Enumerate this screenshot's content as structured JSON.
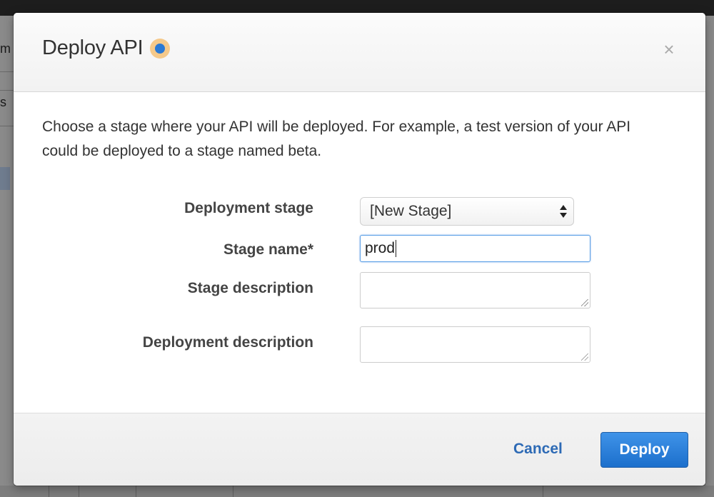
{
  "background": {
    "fragments": [
      "m",
      "s"
    ]
  },
  "modal": {
    "title": "Deploy API",
    "close_symbol": "×",
    "intro": "Choose a stage where your API will be deployed. For example, a test version of your API could be deployed to a stage named beta."
  },
  "form": {
    "deployment_stage": {
      "label": "Deployment stage",
      "selected": "[New Stage]"
    },
    "stage_name": {
      "label": "Stage name*",
      "value": "prod"
    },
    "stage_description": {
      "label": "Stage description",
      "value": ""
    },
    "deployment_description": {
      "label": "Deployment description",
      "value": ""
    }
  },
  "footer": {
    "cancel_label": "Cancel",
    "deploy_label": "Deploy"
  },
  "colors": {
    "primary": "#1c6fcc",
    "link": "#2d6ab5",
    "status_ring": "#f5c98a",
    "status_dot": "#2a79d4"
  }
}
